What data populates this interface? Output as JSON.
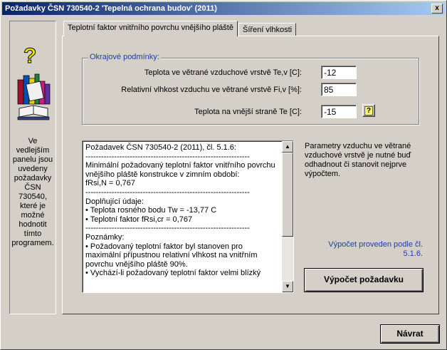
{
  "window": {
    "title": "Požadavky ČSN 730540-2 'Tepelná ochrana budov' (2011)",
    "close_glyph": "x"
  },
  "left_panel": {
    "icon": "books-help-icon",
    "text": "Ve vedlejším panelu jsou uvedeny požadavky ČSN 730540, které je možné hodnotit tímto programem."
  },
  "tabs": [
    {
      "label": "Teplotní faktor vnitřního povrchu vnějšího pláště",
      "active": true
    },
    {
      "label": "Šíření vlhkosti",
      "active": false
    }
  ],
  "conditions": {
    "legend": "Okrajové podmínky:",
    "fields": [
      {
        "label": "Teplota ve větrané vzduchové vrstvě Te,v [C]:",
        "value": "-12"
      },
      {
        "label": "Relativní vlhkost vzduchu ve větrané vrstvě Fi,v [%]:",
        "value": "85"
      },
      {
        "label": "Teplota na vnější straně Te [C]:",
        "value": "-15"
      }
    ],
    "help_button_glyph": "?"
  },
  "memo": {
    "text": "Požadavek ČSN 730540-2 (2011), čl. 5.1.6:\n---------------------------------------------------------------\nMinimální požadovaný teplotní faktor vnitřního povrchu vnějšího pláště konstrukce v zimním období:\nfRsi,N = 0,767\n---------------------------------------------------------------\nDoplňující údaje:\n• Teplota rosného bodu Tw = -13,77 C\n• Teplotní faktor fRsi,cr = 0,767\n---------------------------------------------------------------\nPoznámky:\n• Požadovaný teplotní faktor byl stanoven pro maximální přípustnou relativní vlhkost na vnitřním povrchu vnějšího pláště 90%.\n• Vychází-li požadovaný teplotní faktor velmi blízký",
    "scroll_up_glyph": "▲",
    "scroll_down_glyph": "▼"
  },
  "note": "Parametry vzduchu ve větrané vzduchové vrstvě je nutné buď odhadnout či stanovit nejprve výpočtem.",
  "result": "Výpočet proveden podle čl. 5.1.6.",
  "calc_button": "Výpočet požadavku",
  "back_button": "Návrat"
}
